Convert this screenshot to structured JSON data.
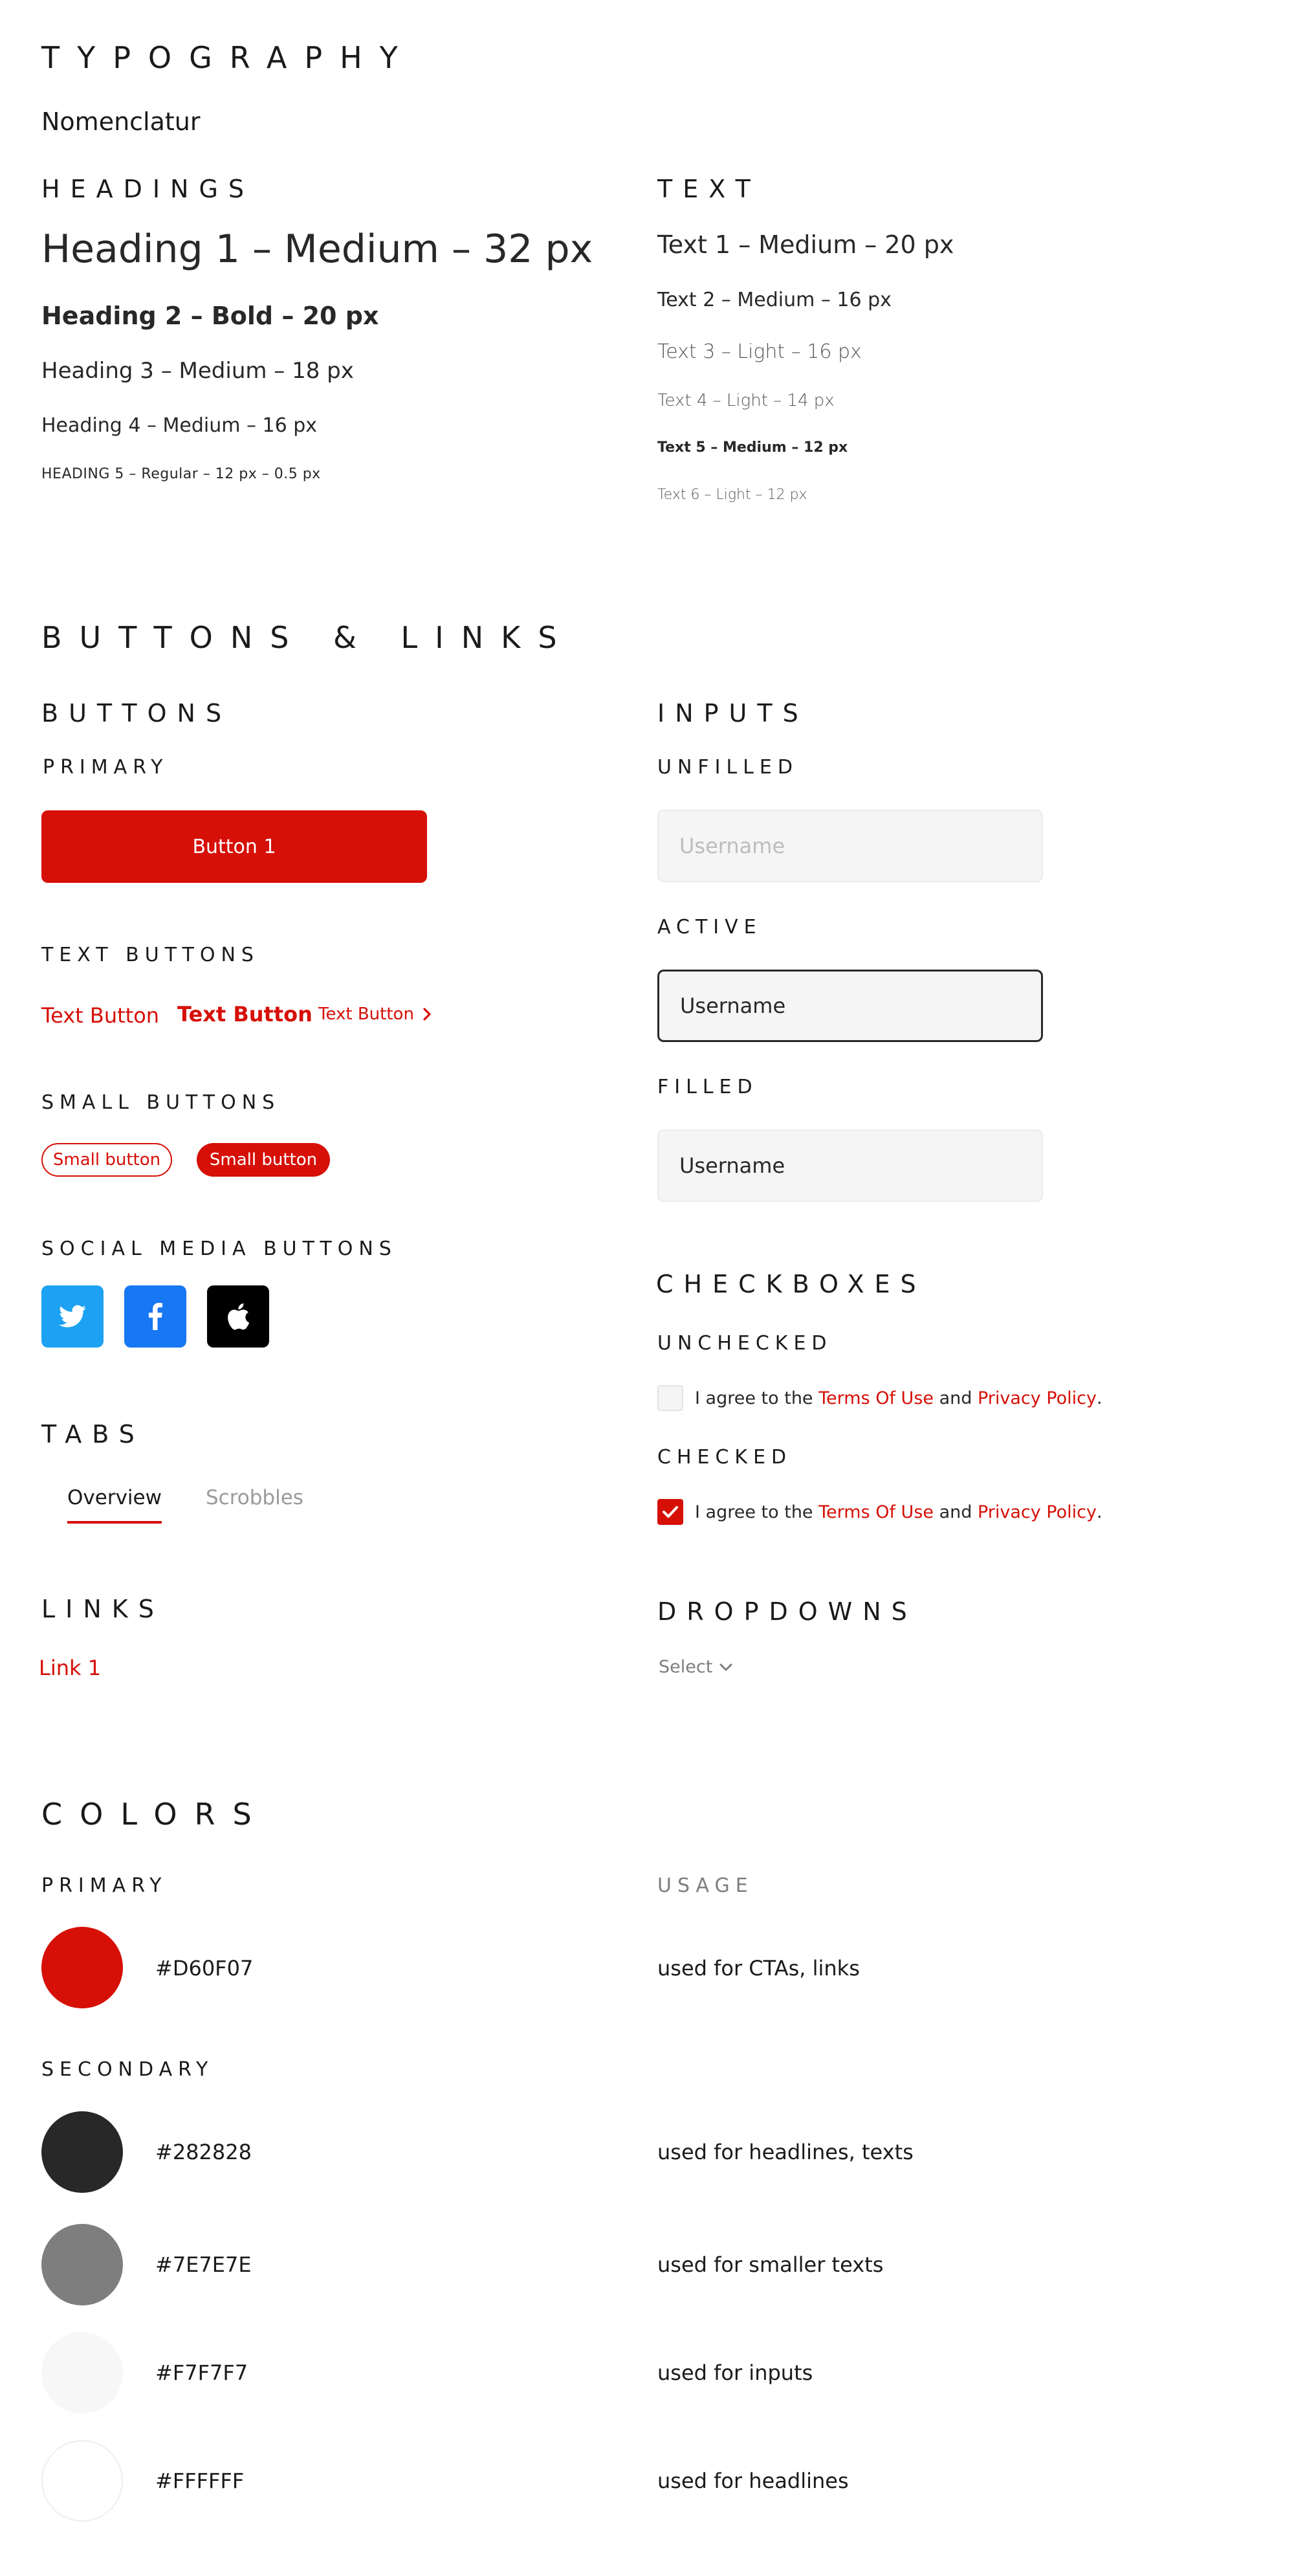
{
  "typography": {
    "title": "TYPOGRAPHY",
    "subtitle": "Nomenclatur",
    "headings": {
      "title": "HEADINGS",
      "h1": "Heading 1 – Medium – 32 px",
      "h2": "Heading 2 – Bold – 20 px",
      "h3": "Heading 3 – Medium – 18 px",
      "h4": "Heading 4 – Medium – 16 px",
      "h5": "HEADING 5 – Regular – 12 px – 0.5 px"
    },
    "text": {
      "title": "TEXT",
      "t1": "Text 1 – Medium – 20 px",
      "t2": "Text 2 – Medium – 16 px",
      "t3": "Text 3 – Light – 16 px",
      "t4": "Text 4 – Light – 14 px",
      "t5": "Text 5 – Medium – 12 px",
      "t6": "Text 6 – Light – 12 px"
    }
  },
  "buttons_links": {
    "title": "BUTTONS & LINKS",
    "buttons": {
      "title": "BUTTONS",
      "primary_label": "PRIMARY",
      "primary_button": "Button 1",
      "text_buttons_label": "TEXT BUTTONS",
      "text_button_1": "Text Button",
      "text_button_2": "Text Button",
      "text_button_3": "Text Button",
      "small_buttons_label": "SMALL BUTTONS",
      "small_outline": "Small button",
      "small_filled": "Small button",
      "social_label": "SOCIAL MEDIA BUTTONS",
      "social_icons": [
        "twitter-icon",
        "facebook-icon",
        "apple-icon"
      ],
      "social_colors": [
        "#1DA1F2",
        "#1877F2",
        "#000000"
      ]
    },
    "tabs": {
      "title": "TABS",
      "items": [
        "Overview",
        "Scrobbles"
      ]
    },
    "links": {
      "title": "LINKS",
      "link_1": "Link 1"
    },
    "inputs": {
      "title": "INPUTS",
      "unfilled_label": "UNFILLED",
      "unfilled_placeholder": "Username",
      "active_label": "ACTIVE",
      "active_value": "Username",
      "filled_label": "FILLED",
      "filled_value": "Username"
    },
    "checkboxes": {
      "title": "CHECKBOXES",
      "unchecked_label": "UNCHECKED",
      "checked_label": "CHECKED",
      "text_prefix": "I agree to the ",
      "terms": "Terms Of Use",
      "and": " and ",
      "privacy": "Privacy Policy",
      "period": "."
    },
    "dropdowns": {
      "title": "DROPDOWNS",
      "value": "Select"
    }
  },
  "colors": {
    "title": "COLORS",
    "primary_label": "PRIMARY",
    "usage_label": "USAGE",
    "secondary_label": "SECONDARY",
    "primary": [
      {
        "hex": "#D60F07",
        "usage": "used for CTAs, links"
      }
    ],
    "secondary": [
      {
        "hex": "#282828",
        "usage": "used for headlines, texts"
      },
      {
        "hex": "#7E7E7E",
        "usage": "used for smaller texts"
      },
      {
        "hex": "#F7F7F7",
        "usage": "used for inputs"
      },
      {
        "hex": "#FFFFFF",
        "usage": "used for headlines"
      }
    ]
  }
}
